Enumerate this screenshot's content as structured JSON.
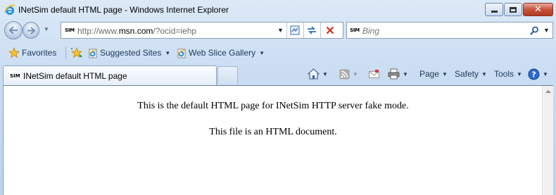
{
  "window": {
    "title": "INetSim default HTML page - Windows Internet Explorer",
    "caption_buttons": {
      "minimize_icon": "minimize-icon",
      "maximize_icon": "maximize-icon",
      "close_glyph": "✕"
    }
  },
  "navigation": {
    "address_badge": "SIM",
    "address_url_prefix": "http://www.",
    "address_url_domain": "msn.com",
    "address_url_suffix": "/?ocid=iehp",
    "search_badge": "SIM",
    "search_placeholder": "Bing"
  },
  "favorites_bar": {
    "favorites_label": "Favorites",
    "items": [
      {
        "label": "Suggested Sites",
        "icon": "ie-page-icon"
      },
      {
        "label": "Web Slice Gallery",
        "icon": "ie-page-icon"
      }
    ]
  },
  "tab": {
    "title": "INetSim default HTML page"
  },
  "command_bar": {
    "page_label": "Page",
    "safety_label": "Safety",
    "tools_label": "Tools"
  },
  "content": {
    "line1": "This is the default HTML page for INetSim HTTP server fake mode.",
    "line2": "This file is an HTML document."
  },
  "colors": {
    "chrome_gradient_top": "#dce9f7",
    "chrome_gradient_bottom": "#bcd3ee",
    "close_button_red": "#c7533c",
    "text_chrome": "#1e395b"
  }
}
